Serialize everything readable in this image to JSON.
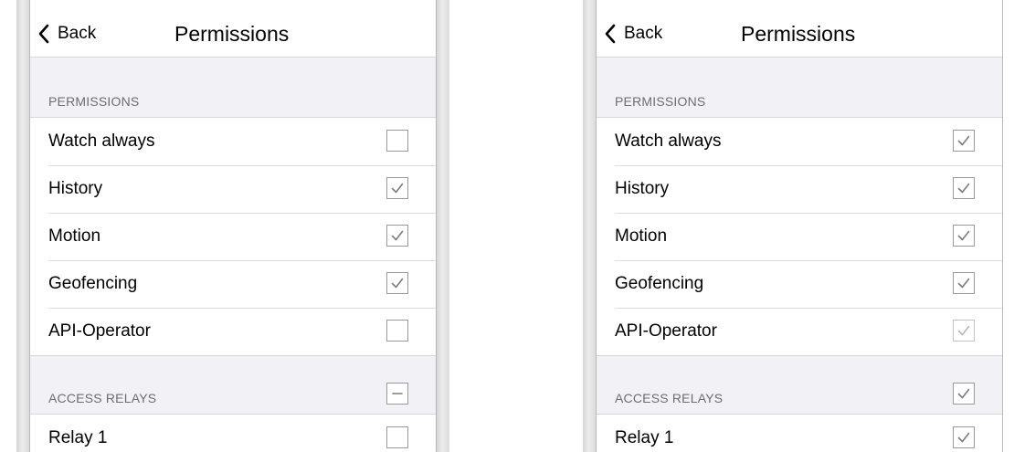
{
  "screens": [
    {
      "nav": {
        "back_label": "Back",
        "title": "Permissions"
      },
      "permissions_header": "PERMISSIONS",
      "permissions": [
        {
          "label": "Watch always",
          "state": "unchecked"
        },
        {
          "label": "History",
          "state": "checked"
        },
        {
          "label": "Motion",
          "state": "checked"
        },
        {
          "label": "Geofencing",
          "state": "checked"
        },
        {
          "label": "API-Operator",
          "state": "unchecked"
        }
      ],
      "relays_header": "ACCESS RELAYS",
      "relays_header_state": "indeterminate",
      "relays": [
        {
          "label": "Relay 1",
          "state": "unchecked"
        }
      ]
    },
    {
      "nav": {
        "back_label": "Back",
        "title": "Permissions"
      },
      "permissions_header": "PERMISSIONS",
      "permissions": [
        {
          "label": "Watch always",
          "state": "checked"
        },
        {
          "label": "History",
          "state": "checked"
        },
        {
          "label": "Motion",
          "state": "checked"
        },
        {
          "label": "Geofencing",
          "state": "checked"
        },
        {
          "label": "API-Operator",
          "state": "checked-disabled"
        }
      ],
      "relays_header": "ACCESS RELAYS",
      "relays_header_state": "checked",
      "relays": [
        {
          "label": "Relay 1",
          "state": "checked"
        }
      ]
    }
  ],
  "colors": {
    "checkmark": "#7d7d7d",
    "checkmark_disabled": "#b8b8b8",
    "group_background": "#f2f2f6",
    "separator": "#d7d7da"
  },
  "icons": {
    "back": "chevron-left-icon",
    "checked": "checkmark-icon",
    "indeterminate": "minus-icon"
  }
}
